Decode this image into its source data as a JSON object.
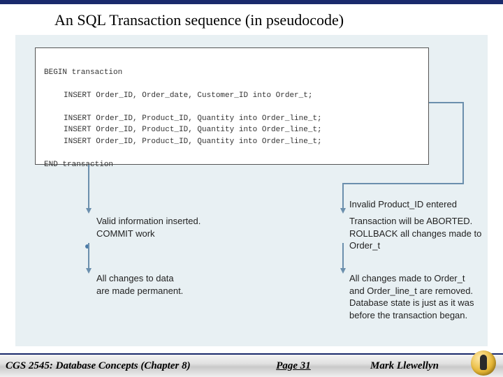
{
  "title": "An SQL Transaction sequence (in pseudocode)",
  "code": {
    "begin": "BEGIN transaction",
    "line1": "INSERT Order_ID, Order_date, Customer_ID into Order_t;",
    "line2": "INSERT Order_ID, Product_ID, Quantity into Order_line_t;",
    "line3": "INSERT Order_ID, Product_ID, Quantity into Order_line_t;",
    "line4": "INSERT Order_ID, Product_ID, Quantity into Order_line_t;",
    "end": "END transaction"
  },
  "left": {
    "step1": "Valid information inserted.\nCOMMIT work",
    "step2": "All changes to data\nare made permanent."
  },
  "right": {
    "trigger": "Invalid Product_ID entered",
    "step1": "Transaction will be ABORTED.\nROLLBACK all changes made to Order_t",
    "step2": "All changes made to Order_t\nand Order_line_t are removed.\nDatabase state is just as it was\nbefore the transaction began."
  },
  "footer": {
    "course": "CGS 2545: Database Concepts  (Chapter 8)",
    "page": "Page 31",
    "author": "Mark Llewellyn"
  }
}
